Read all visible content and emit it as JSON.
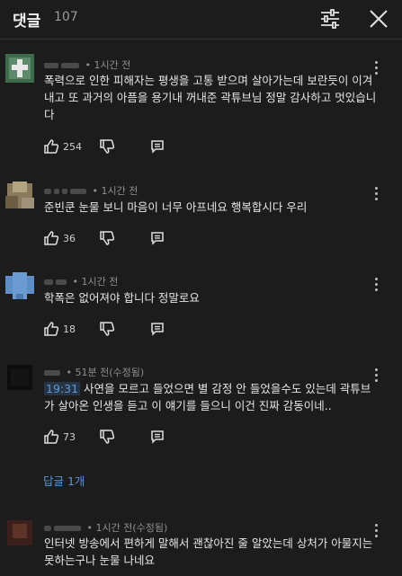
{
  "header": {
    "title": "댓글",
    "count": "107"
  },
  "comments": [
    {
      "time": "• 1시간 전",
      "text": "폭력으로 인한 피해자는 평생을 고통 받으며 살아가는데 보란듯이 이겨내고 또 과거의 아픔을 용기내 꺼내준 곽튜브님 정말 감사하고 멋있습니다",
      "likes": "254"
    },
    {
      "time": "• 1시간 전",
      "text": "준빈쿤 눈물 보니 마음이 너무 아프네요 행복합시다 우리",
      "likes": "36"
    },
    {
      "time": "• 1시간 전",
      "text": "학폭은 없어져야 합니다 정말로요",
      "likes": "18"
    },
    {
      "time": "• 51분 전(수정됨)",
      "timestamp": "19:31",
      "text": " 사연을 모르고 들었으면 별 감정 안 들었을수도 있는데 곽튜브가 살아온 인생을 듣고 이 얘기를 들으니 이건 진짜 감동이네..",
      "likes": "73",
      "replies": "답글 1개"
    },
    {
      "time": "• 1시간 전(수정됨)",
      "text": "인터넷 방송에서 편하게 말해서 괜찮아진 줄 알았는데 상처가 아물지는 못하는구나 눈물 나네요"
    }
  ]
}
